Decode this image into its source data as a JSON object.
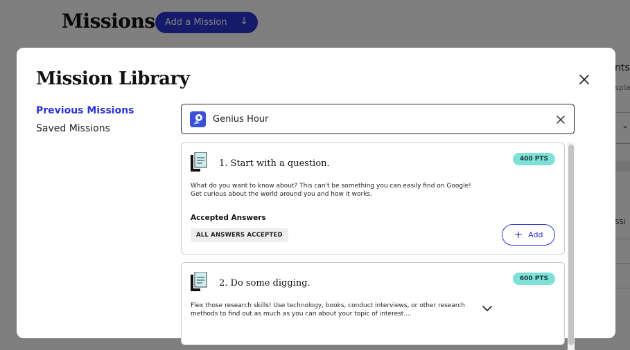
{
  "background": {
    "page_title": "Missions",
    "add_mission_label": "Add a Mission",
    "right_peek_text1": "nts",
    "right_peek_text2": "splay",
    "right_peek_text3": "ISSI"
  },
  "modal": {
    "title": "Mission Library",
    "nav": {
      "active": "Previous Missions",
      "inactive": "Saved Missions"
    },
    "search": {
      "value": "Genius Hour"
    },
    "missions": [
      {
        "title": "1. Start with a question.",
        "points": "400 PTS",
        "description": "What do you want to know about? This can't be something you can easily find on Google! Get curious about the world around you and how it works.",
        "answers_label": "Accepted Answers",
        "answers_tag": "ALL ANSWERS ACCEPTED",
        "add_label": "Add"
      },
      {
        "title": "2. Do some digging.",
        "points": "600 PTS",
        "description": "Flex those research skills! Use technology, books, conduct interviews, or other research methods to find out as much as you can about your topic of interest...."
      }
    ]
  },
  "colors": {
    "accent": "#2b34d4",
    "badge": "#7ee0d6",
    "overlay": "rgba(0,0,0,0.5)"
  },
  "icons": [
    "arrow-down-icon",
    "close-icon",
    "genius-hour-icon",
    "mission-doc-icon",
    "plus-icon",
    "chevron-down-icon"
  ]
}
